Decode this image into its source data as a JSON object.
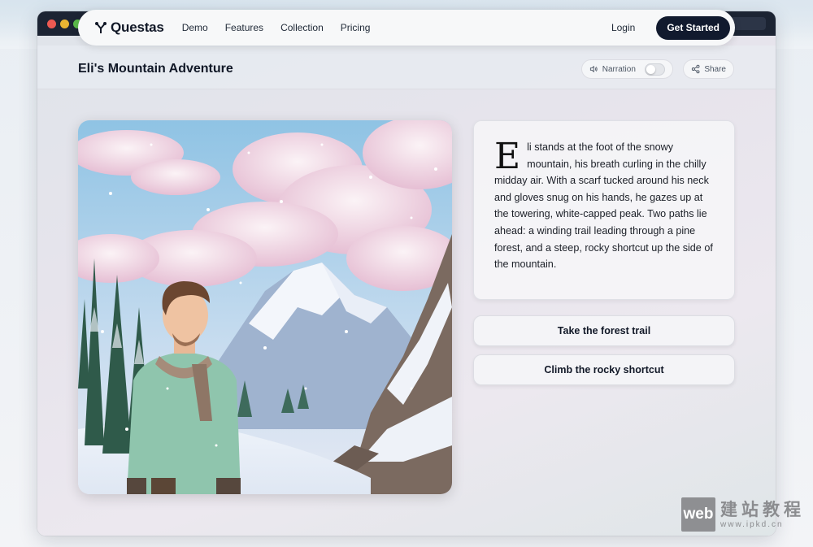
{
  "colors": {
    "accent": "#111a2e",
    "titlebar": "#1c2433",
    "page_bg": "#e9eef3"
  },
  "nav": {
    "brand": "Questas",
    "brand_icon": "branch-logo-icon",
    "links": [
      "Demo",
      "Features",
      "Collection",
      "Pricing"
    ],
    "login": "Login",
    "cta": "Get Started"
  },
  "story": {
    "title": "Eli's Mountain Adventure",
    "narration_label": "Narration",
    "narration_on": false,
    "share_label": "Share",
    "dropcap": "E",
    "text": "li stands at the foot of the snowy mountain, his breath curling in the chilly midday air. With a scarf tucked around his neck and gloves snug on his hands, he gazes up at the towering, white-capped peak. Two paths lie ahead: a winding trail leading through a pine forest, and a steep, rocky shortcut up the side of the mountain.",
    "choices": [
      "Take the forest trail",
      "Climb the rocky shortcut"
    ]
  },
  "watermark": {
    "box": "web",
    "cn": "建站教程",
    "url": "www.ipkd.cn"
  }
}
